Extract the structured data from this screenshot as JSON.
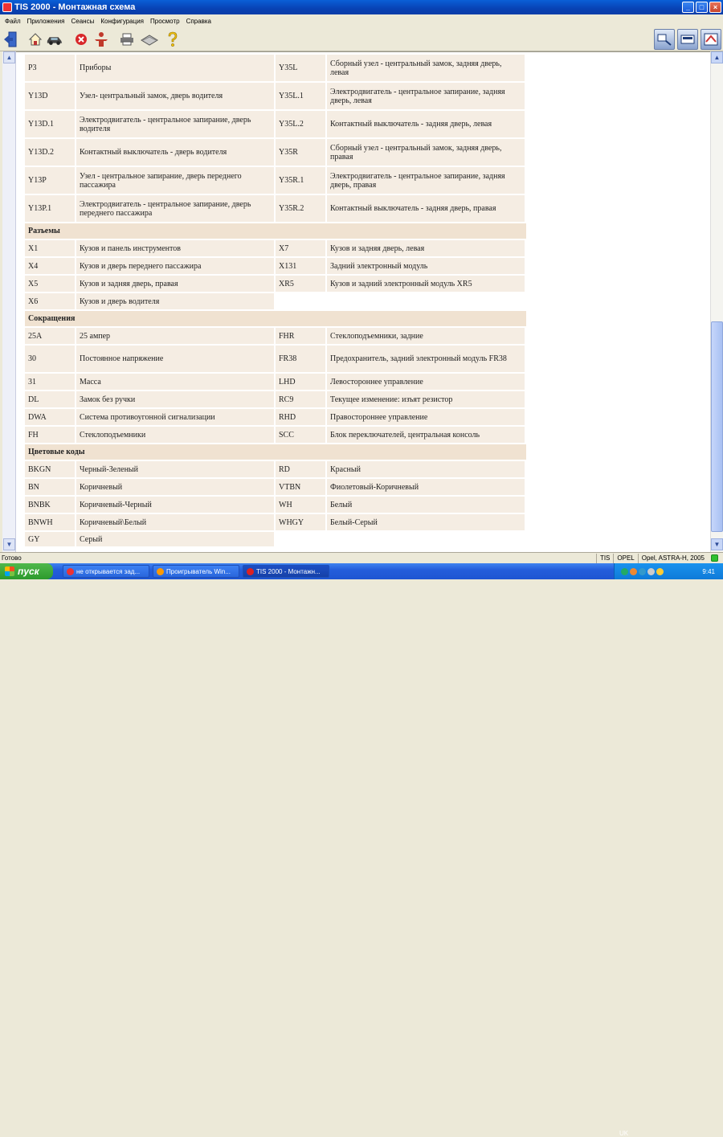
{
  "window": {
    "title": "TIS 2000 - Монтажная схема"
  },
  "menu": [
    "Файл",
    "Приложения",
    "Сеансы",
    "Конфигурация",
    "Просмотр",
    "Справка"
  ],
  "table": {
    "top_rows": [
      {
        "c1": "P3",
        "d1": "Приборы",
        "c2": "Y35L",
        "d2": "Сборный узел - центральный замок, задняя дверь, левая"
      },
      {
        "c1": "Y13D",
        "d1": "Узел- центральный замок, дверь водителя",
        "c2": "Y35L.1",
        "d2": "Электродвигатель - центральное запирание, задняя дверь, левая"
      },
      {
        "c1": "Y13D.1",
        "d1": "Электродвигатель - центральное запирание, дверь водителя",
        "c2": "Y35L.2",
        "d2": "Контактный выключатель - задняя дверь, левая"
      },
      {
        "c1": "Y13D.2",
        "d1": "Контактный выключатель - дверь водителя",
        "c2": "Y35R",
        "d2": "Сборный узел - центральный замок, задняя дверь, правая"
      },
      {
        "c1": "Y13P",
        "d1": "Узел - центральное запирание, дверь переднего пассажира",
        "c2": "Y35R.1",
        "d2": "Электродвигатель - центральное запирание, задняя дверь, правая"
      },
      {
        "c1": "Y13P.1",
        "d1": "Электродвигатель - центральное запирание, дверь переднего пассажира",
        "c2": "Y35R.2",
        "d2": "Контактный выключатель - задняя дверь, правая"
      }
    ],
    "sections": [
      {
        "title": "Разъемы",
        "rows": [
          {
            "c1": "X1",
            "d1": "Кузов и панель инструментов",
            "c2": "X7",
            "d2": "Кузов и задняя дверь, левая"
          },
          {
            "c1": "X4",
            "d1": "Кузов и дверь переднего пассажира",
            "c2": "X131",
            "d2": "Задний электронный модуль"
          },
          {
            "c1": "X5",
            "d1": "Кузов и задняя дверь, правая",
            "c2": "XR5",
            "d2": "Кузов и задний электронный модуль XR5"
          },
          {
            "c1": "X6",
            "d1": "Кузов и дверь водителя",
            "c2": "",
            "d2": ""
          }
        ]
      },
      {
        "title": "Сокращения",
        "rows": [
          {
            "c1": "25A",
            "d1": "25 ампер",
            "c2": "FHR",
            "d2": "Стеклоподъемники, задние"
          },
          {
            "c1": "30",
            "d1": "Постоянное напряжение",
            "c2": "FR38",
            "d2": "Предохранитель, задний электронный модуль FR38"
          },
          {
            "c1": "31",
            "d1": "Масса",
            "c2": "LHD",
            "d2": "Левостороннее управление"
          },
          {
            "c1": "DL",
            "d1": "Замок без ручки",
            "c2": "RC9",
            "d2": "Текущее изменение: изъят резистор"
          },
          {
            "c1": "DWA",
            "d1": "Система противоугонной сигнализации",
            "c2": "RHD",
            "d2": "Правостороннее управление"
          },
          {
            "c1": "FH",
            "d1": "Стеклоподъемники",
            "c2": "SCC",
            "d2": "Блок переключателей, центральная консоль"
          }
        ]
      },
      {
        "title": "Цветовые коды",
        "rows": [
          {
            "c1": "BKGN",
            "d1": "Черный-Зеленый",
            "c2": "RD",
            "d2": "Красный"
          },
          {
            "c1": "BN",
            "d1": "Коричневый",
            "c2": "VTBN",
            "d2": "Фиолетовый-Коричневый"
          },
          {
            "c1": "BNBK",
            "d1": "Коричневый-Черный",
            "c2": "WH",
            "d2": "Белый"
          },
          {
            "c1": "BNWH",
            "d1": "Коричневый\\Белый",
            "c2": "WHGY",
            "d2": "Белый-Серый"
          },
          {
            "c1": "GY",
            "d1": "Серый",
            "c2": "",
            "d2": ""
          }
        ]
      }
    ]
  },
  "status": {
    "text": "Готово",
    "pane1": "TIS",
    "pane2": "OPEL",
    "pane3": "Opel, ASTRA-H, 2005"
  },
  "taskbar": {
    "start": "пуск",
    "tasks": [
      "не открывается зад...",
      "Проигрыватель Win...",
      "TIS 2000 - Монтажн..."
    ],
    "lang": "UK",
    "clock": "9:41"
  },
  "icons": {
    "toolbar": [
      "exit-icon",
      "home-icon",
      "car-icon",
      "stop-icon",
      "person-icon",
      "print-icon",
      "book-icon",
      "help-icon"
    ],
    "toolbar_right": [
      "diagnostics-icon",
      "tech-icon",
      "settings-panel-icon"
    ]
  }
}
